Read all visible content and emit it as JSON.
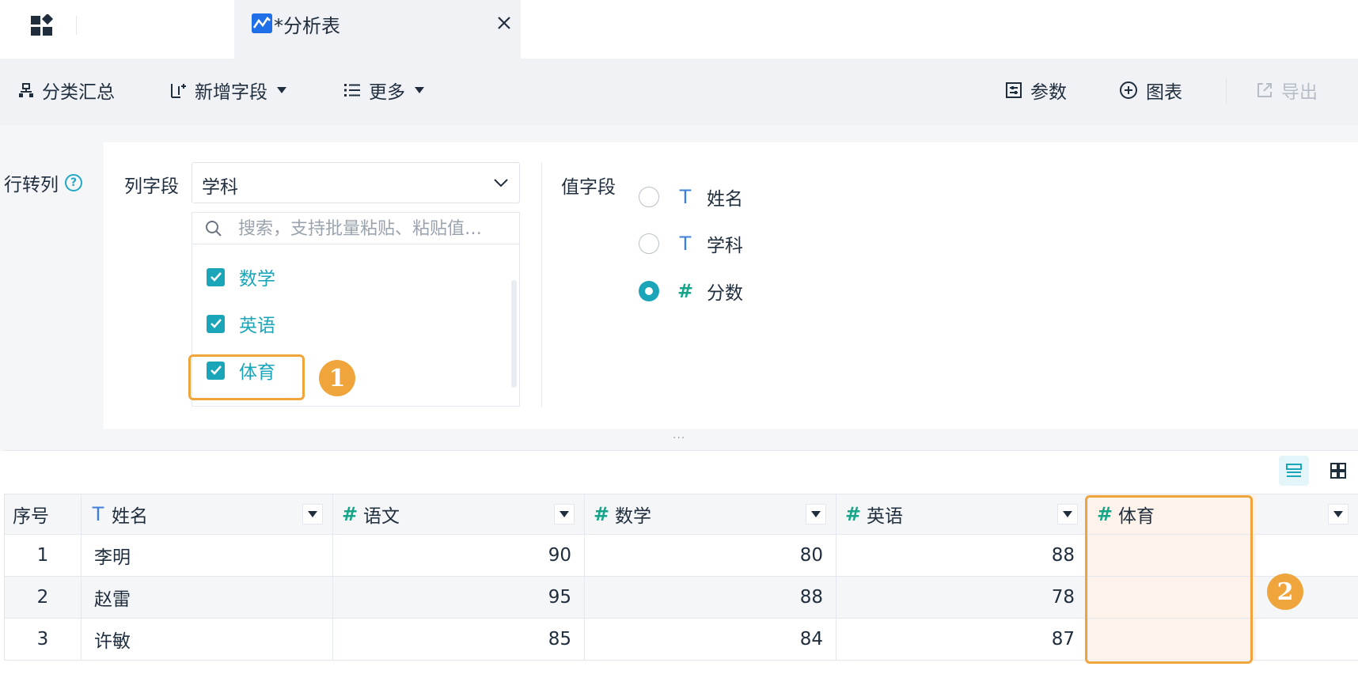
{
  "tab": {
    "title": "*分析表",
    "close": "×"
  },
  "toolbar": {
    "group_summary": "分类汇总",
    "add_field": "新增字段",
    "more": "更多",
    "params": "参数",
    "chart": "图表",
    "export": "导出"
  },
  "config": {
    "side_label": "行转列",
    "help": "?",
    "column_field_label": "列字段",
    "column_field_value": "学科",
    "search_placeholder": "搜索，支持批量粘贴、粘贴值…",
    "options": [
      {
        "label": "数学",
        "checked": true
      },
      {
        "label": "英语",
        "checked": true
      },
      {
        "label": "体育",
        "checked": true
      }
    ],
    "value_field_label": "值字段",
    "value_fields": [
      {
        "type": "T",
        "label": "姓名",
        "selected": false
      },
      {
        "type": "T",
        "label": "学科",
        "selected": false
      },
      {
        "type": "#",
        "label": "分数",
        "selected": true
      }
    ],
    "resize_handle": "···"
  },
  "badges": {
    "one": "1",
    "two": "2"
  },
  "table": {
    "headers": [
      {
        "type": "",
        "label": "序号"
      },
      {
        "type": "T",
        "label": "姓名"
      },
      {
        "type": "#",
        "label": "语文"
      },
      {
        "type": "#",
        "label": "数学"
      },
      {
        "type": "#",
        "label": "英语"
      },
      {
        "type": "#",
        "label": "体育"
      }
    ],
    "rows": [
      [
        "1",
        "李明",
        "90",
        "80",
        "88",
        ""
      ],
      [
        "2",
        "赵雷",
        "95",
        "88",
        "78",
        ""
      ],
      [
        "3",
        "许敏",
        "85",
        "84",
        "87",
        ""
      ]
    ]
  },
  "colors": {
    "accent": "#1aa5b8",
    "highlight": "#f0a43c",
    "text_type": "#3d7fd9",
    "number_type": "#15a68a"
  }
}
